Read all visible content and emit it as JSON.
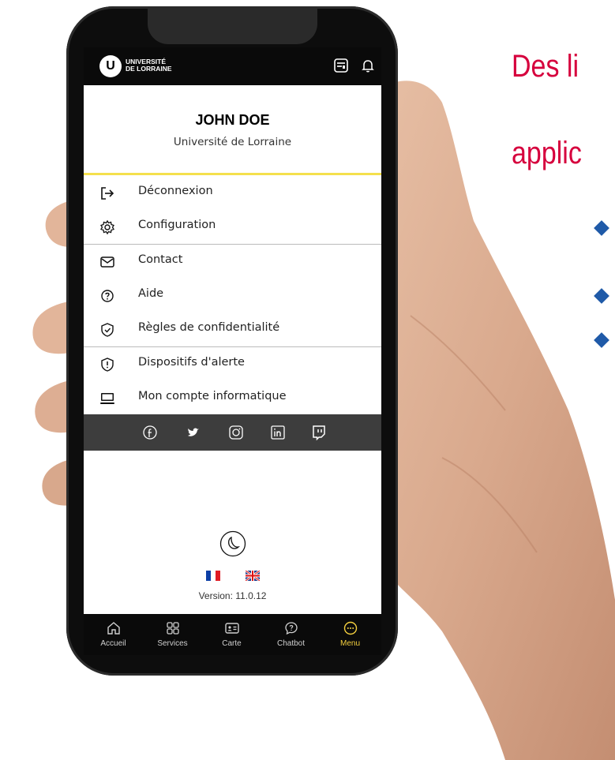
{
  "headline": {
    "line1": "Des li",
    "line2": "applic"
  },
  "colors": {
    "accent_red": "#d6003d",
    "bullet_blue": "#1f5aa8",
    "active_yellow": "#f4d03f"
  },
  "app": {
    "logo_line1": "UNIVERSITÉ",
    "logo_line2": "DE LORRAINE",
    "top_icons": [
      "card-icon",
      "bell-icon"
    ]
  },
  "profile": {
    "name": "JOHN DOE",
    "org": "Université de Lorraine"
  },
  "menu": [
    {
      "label": "Déconnexion",
      "icon": "logout-icon"
    },
    {
      "label": "Configuration",
      "icon": "gear-icon"
    },
    {
      "label": "Contact",
      "icon": "mail-icon"
    },
    {
      "label": "Aide",
      "icon": "help-icon"
    },
    {
      "label": "Règles de confidentialité",
      "icon": "shield-check-icon"
    },
    {
      "label": "Dispositifs d'alerte",
      "icon": "alert-shield-icon"
    },
    {
      "label": "Mon compte informatique",
      "icon": "monitor-icon"
    }
  ],
  "social": [
    "facebook-icon",
    "twitter-icon",
    "instagram-icon",
    "linkedin-icon",
    "twitch-icon"
  ],
  "theme_toggle": "moon-icon",
  "languages": [
    "fr-flag-icon",
    "uk-flag-icon"
  ],
  "version": "Version: 11.0.12",
  "nav": [
    {
      "label": "Accueil",
      "icon": "home-icon",
      "active": false
    },
    {
      "label": "Services",
      "icon": "grid-icon",
      "active": false
    },
    {
      "label": "Carte",
      "icon": "id-card-icon",
      "active": false
    },
    {
      "label": "Chatbot",
      "icon": "chat-icon",
      "active": false
    },
    {
      "label": "Menu",
      "icon": "more-icon",
      "active": true
    }
  ]
}
